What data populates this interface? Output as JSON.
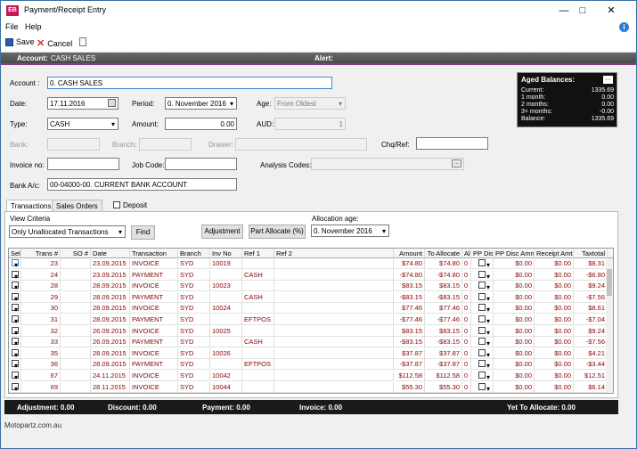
{
  "window": {
    "app_badge": "EB",
    "title": "Payment/Receipt Entry"
  },
  "menu": {
    "file": "File",
    "help": "Help"
  },
  "toolbar": {
    "save": "Save",
    "cancel": "Cancel"
  },
  "header": {
    "account_label": "Account:",
    "account_value": "CASH SALES",
    "alert_label": "Alert:"
  },
  "form": {
    "account_label": "Account :",
    "account_value": "0. CASH SALES",
    "date_label": "Date:",
    "date_value": "17.11.2016",
    "period_label": "Period:",
    "period_value": "0. November 2016",
    "age_label": "Age:",
    "age_value": "From Oldest",
    "type_label": "Type:",
    "type_value": "CASH",
    "amount_label": "Amount:",
    "amount_value": "0.00",
    "aud_label": "AUD:",
    "aud_value": "1",
    "bank_label": "Bank:",
    "branch_label": "Branch:",
    "drawer_label": "Drawer:",
    "chqref_label": "Chq/Ref:",
    "invoice_label": "Invoice no:",
    "jobcode_label": "Job Code:",
    "analysis_label": "Analysis Codes:",
    "bank_ac_label": "Bank A/c:",
    "bank_ac_value": "00-04000-00. CURRENT BANK ACCOUNT"
  },
  "aged": {
    "title": "Aged Balances:",
    "rows": [
      {
        "label": "Current:",
        "value": "1335.69"
      },
      {
        "label": "1 month:",
        "value": "0.00"
      },
      {
        "label": "2 months:",
        "value": "0.00"
      },
      {
        "label": "3+ months:",
        "value": "-0.00"
      },
      {
        "label": "Balance:",
        "value": "1335.69"
      }
    ]
  },
  "tabs": {
    "transactions": "Transactions",
    "sales_orders": "Sales Orders",
    "deposit": "Deposit"
  },
  "criteria": {
    "label": "View Criteria",
    "value": "Only Unallocated Transactions",
    "find": "Find",
    "adjustment": "Adjustment",
    "part_allocate": "Part Allocate (%)",
    "alloc_age_label": "Allocation age:",
    "alloc_age_value": "0. November 2016"
  },
  "grid": {
    "headers": [
      "Sel",
      "Trans #",
      "SO #",
      "Date",
      "Transaction",
      "Branch",
      "Inv No",
      "Ref 1",
      "Ref 2",
      "Amount",
      "To Allocate",
      "Al",
      "PP Disc",
      "PP Disc Amnt",
      "Receipt Amt",
      "Taxtotal"
    ],
    "rows": [
      {
        "trans": "23",
        "date": "23.09.2015",
        "tx": "INVOICE",
        "branch": "SYD",
        "inv": "10019",
        "ref1": "",
        "amount": "$74.80",
        "alloc": "$74.80",
        "al": "0",
        "ppamt": "$0.00",
        "receipt": "$0.00",
        "tax": "$8.31"
      },
      {
        "trans": "24",
        "date": "23.09.2015",
        "tx": "PAYMENT",
        "branch": "SYD",
        "inv": "",
        "ref1": "CASH",
        "amount": "-$74.80",
        "alloc": "-$74.80",
        "al": "0",
        "ppamt": "$0.00",
        "receipt": "$0.00",
        "tax": "-$6.80"
      },
      {
        "trans": "28",
        "date": "28.09.2015",
        "tx": "INVOICE",
        "branch": "SYD",
        "inv": "10023",
        "ref1": "",
        "amount": "$83.15",
        "alloc": "$83.15",
        "al": "0",
        "ppamt": "$0.00",
        "receipt": "$0.00",
        "tax": "$9.24"
      },
      {
        "trans": "29",
        "date": "28.09.2015",
        "tx": "PAYMENT",
        "branch": "SYD",
        "inv": "",
        "ref1": "CASH",
        "amount": "-$83.15",
        "alloc": "-$83.15",
        "al": "0",
        "ppamt": "$0.00",
        "receipt": "$0.00",
        "tax": "-$7.56"
      },
      {
        "trans": "30",
        "date": "28.09.2015",
        "tx": "INVOICE",
        "branch": "SYD",
        "inv": "10024",
        "ref1": "",
        "amount": "$77.46",
        "alloc": "$77.46",
        "al": "0",
        "ppamt": "$0.00",
        "receipt": "$0.00",
        "tax": "$8.61"
      },
      {
        "trans": "31",
        "date": "28.09.2015",
        "tx": "PAYMENT",
        "branch": "SYD",
        "inv": "",
        "ref1": "EFTPOS",
        "amount": "-$77.46",
        "alloc": "-$77.46",
        "al": "0",
        "ppamt": "$0.00",
        "receipt": "$0.00",
        "tax": "-$7.04"
      },
      {
        "trans": "32",
        "date": "26.09.2015",
        "tx": "INVOICE",
        "branch": "SYD",
        "inv": "10025",
        "ref1": "",
        "amount": "$83.15",
        "alloc": "$83.15",
        "al": "0",
        "ppamt": "$0.00",
        "receipt": "$0.00",
        "tax": "$9.24"
      },
      {
        "trans": "33",
        "date": "26.09.2015",
        "tx": "PAYMENT",
        "branch": "SYD",
        "inv": "",
        "ref1": "CASH",
        "amount": "-$83.15",
        "alloc": "-$83.15",
        "al": "0",
        "ppamt": "$0.00",
        "receipt": "$0.00",
        "tax": "-$7.56"
      },
      {
        "trans": "35",
        "date": "28.09.2015",
        "tx": "INVOICE",
        "branch": "SYD",
        "inv": "10026",
        "ref1": "",
        "amount": "$37.87",
        "alloc": "$37.87",
        "al": "0",
        "ppamt": "$0.00",
        "receipt": "$0.00",
        "tax": "$4.21"
      },
      {
        "trans": "36",
        "date": "28.09.2015",
        "tx": "PAYMENT",
        "branch": "SYD",
        "inv": "",
        "ref1": "EFTPOS",
        "amount": "-$37.87",
        "alloc": "-$37.87",
        "al": "0",
        "ppamt": "$0.00",
        "receipt": "$0.00",
        "tax": "-$3.44"
      },
      {
        "trans": "67",
        "date": "24.11.2015",
        "tx": "INVOICE",
        "branch": "SYD",
        "inv": "10042",
        "ref1": "",
        "amount": "$112.58",
        "alloc": "$112.58",
        "al": "0",
        "ppamt": "$0.00",
        "receipt": "$0.00",
        "tax": "$12.51"
      },
      {
        "trans": "69",
        "date": "28.11.2015",
        "tx": "INVOICE",
        "branch": "SYD",
        "inv": "10044",
        "ref1": "",
        "amount": "$55.30",
        "alloc": "$55.30",
        "al": "0",
        "ppamt": "$0.00",
        "receipt": "$0.00",
        "tax": "$6.14"
      }
    ]
  },
  "footer": {
    "adjustment": "Adjustment: 0.00",
    "discount": "Discount: 0.00",
    "payment": "Payment: 0.00",
    "invoice": "Invoice: 0.00",
    "to_allocate": "Yet To Allocate: 0.00"
  },
  "status": "Motopartz.com.au"
}
